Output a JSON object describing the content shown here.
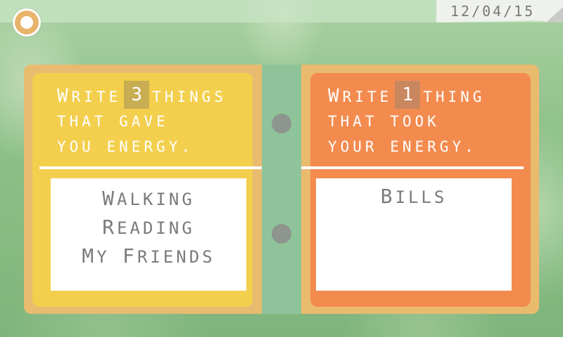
{
  "header": {
    "date": "12/04/15",
    "menu_icon": "circle-menu-icon"
  },
  "left_page": {
    "prompt_lines": [
      "Write",
      "things",
      "that gave",
      "you energy."
    ],
    "count": "3",
    "answers": [
      "Walking",
      "Reading",
      "My Friends"
    ]
  },
  "right_page": {
    "prompt_lines": [
      "Write",
      "thing",
      "that took",
      "your energy."
    ],
    "count": "1",
    "answers": [
      "Bills"
    ]
  },
  "colors": {
    "left_page": "#f3cf4d",
    "right_page": "#f38b4f",
    "book_cover": "#e9bb6f",
    "spine": "#8fc49a",
    "accent": "#e8b36a"
  }
}
